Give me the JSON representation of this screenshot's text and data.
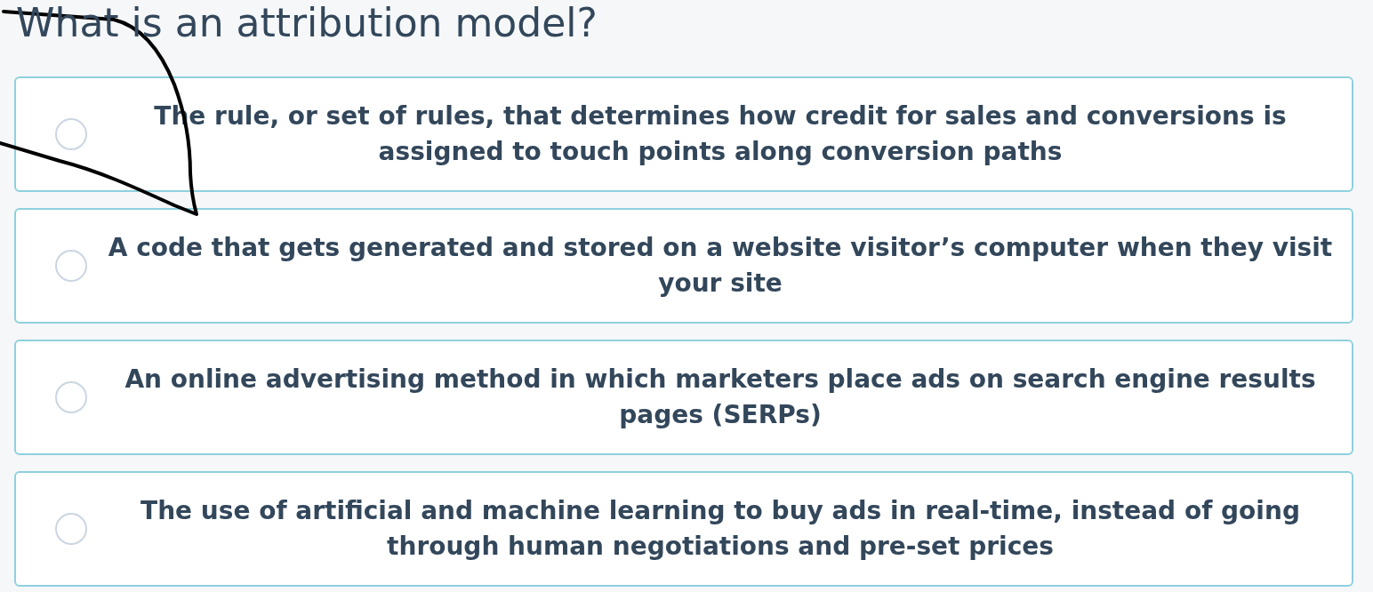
{
  "question": {
    "title": "What is an attribution model?"
  },
  "options": [
    {
      "label": "The rule, or set of rules, that determines how credit for sales and conversions is assigned to touch points along conversion paths",
      "selected": false
    },
    {
      "label": "A code that gets generated and stored on a website visitor’s computer when they visit your site",
      "selected": false
    },
    {
      "label": "An online advertising method in which marketers place ads on search engine results pages (SERPs)",
      "selected": false
    },
    {
      "label": "The use of artificial and machine learning to buy ads in real-time, instead of going through human negotiations and pre-set prices",
      "selected": false
    }
  ]
}
